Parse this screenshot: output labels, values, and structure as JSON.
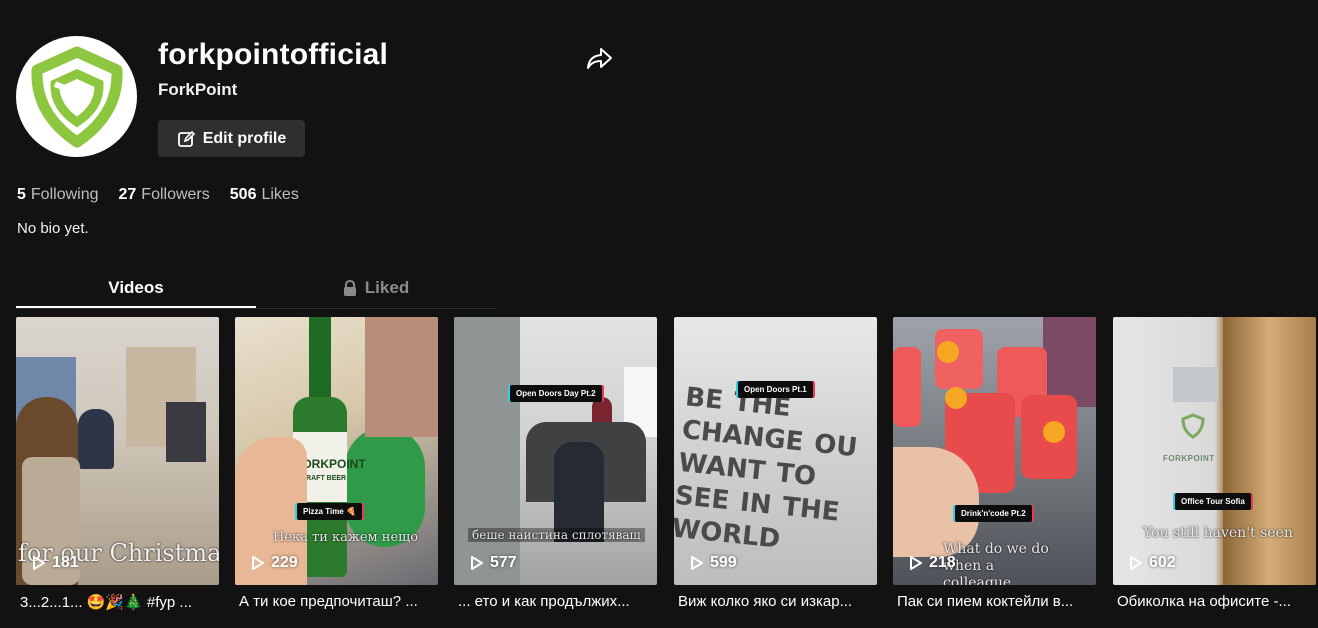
{
  "profile": {
    "username": "forkpointofficial",
    "display_name": "ForkPoint",
    "edit_label": "Edit profile",
    "bio": "No bio yet.",
    "brand_color": "#8dc63f"
  },
  "stats": [
    {
      "value": "5",
      "label": "Following"
    },
    {
      "value": "27",
      "label": "Followers"
    },
    {
      "value": "506",
      "label": "Likes"
    }
  ],
  "tabs": [
    {
      "label": "Videos",
      "active": true
    },
    {
      "label": "Liked",
      "icon": "lock-icon",
      "active": false
    }
  ],
  "videos": [
    {
      "views": "181",
      "caption": "3...2...1... 🤩🎉🎄 #fyp ...",
      "overlay": "for our Christmas",
      "tag": ""
    },
    {
      "views": "229",
      "caption": "А ти кое предпочиташ? ...",
      "overlay": "Нека ти кажем нещо",
      "tag": "Pizza Time 🍕"
    },
    {
      "views": "577",
      "caption": "... ето и как продължих...",
      "overlay": "беше наистина сплотяващ",
      "tag": "Open Doors Day Pt.2"
    },
    {
      "views": "599",
      "caption": "Виж колко яко си изкар...",
      "overlay": "BE THE CHANGE OU WANT TO SEE IN THE WORLD",
      "tag": "Open Doors Pt.1"
    },
    {
      "views": "218",
      "caption": "Пак си пием коктейли в...",
      "overlay": "What do we do when a colleague",
      "tag": "Drink'n'code Pt.2"
    },
    {
      "views": "602",
      "caption": "Обиколка на офисите -...",
      "overlay": "You still haven't seen",
      "tag": "Office Tour Sofia"
    }
  ],
  "thumb_scene": {
    "logo_text": "FORKPOINT",
    "label_text": "CRAFT BEER"
  }
}
